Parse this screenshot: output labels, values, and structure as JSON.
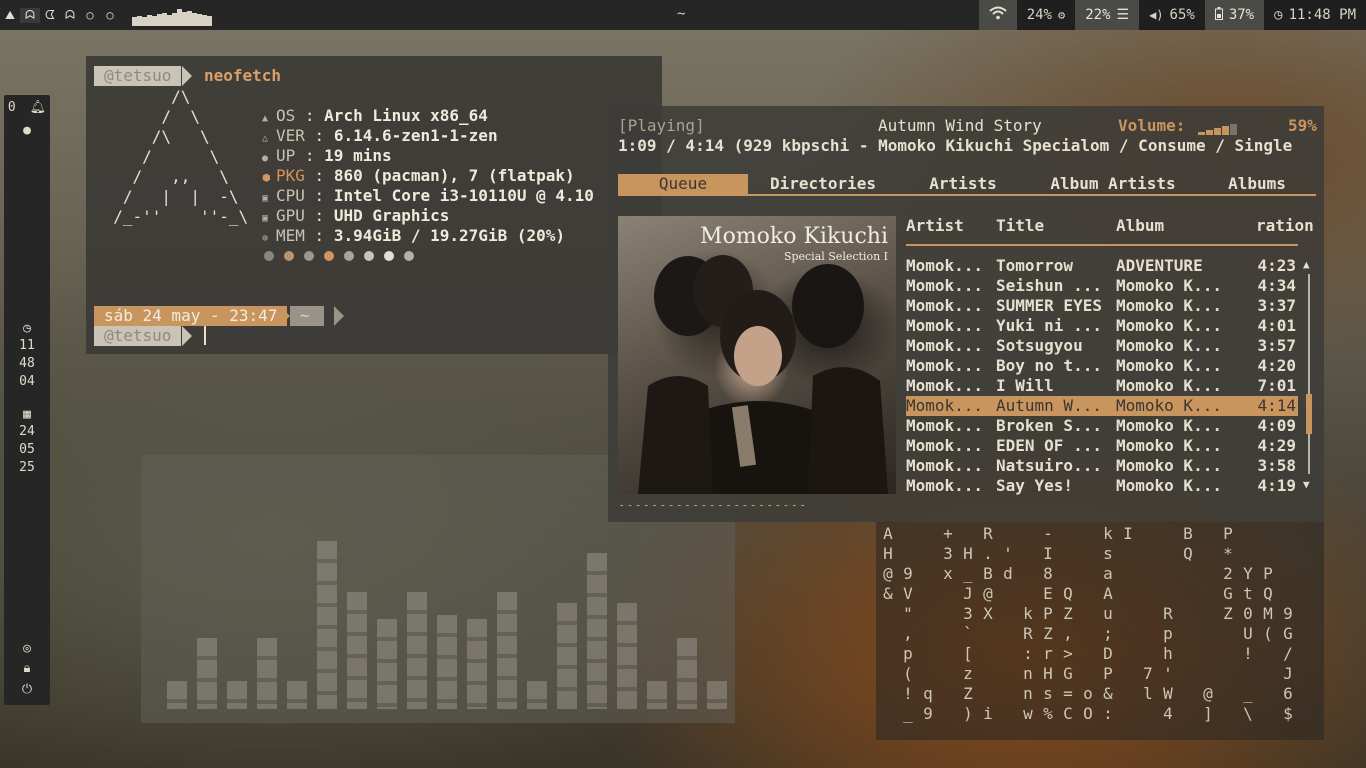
{
  "topbar": {
    "workspaces": [
      "⛰",
      "ᗣ",
      "ᗧ",
      "ᗣ",
      "○",
      "○"
    ],
    "center_title": "~",
    "wifi_icon": "wifi-icon",
    "cpu": "24%",
    "ram": "22%",
    "volume": "65%",
    "battery": "37%",
    "clock": "11:48 PM",
    "cpu_history": [
      0.25,
      0.35,
      0.3,
      0.4,
      0.35,
      0.45,
      0.5,
      0.4,
      0.5,
      0.7,
      0.55,
      0.6,
      0.5,
      0.45,
      0.4,
      0.35
    ]
  },
  "sidebar": {
    "notif_count": "0",
    "clock_h": "11",
    "clock_m": "48",
    "clock_s": "04",
    "date_d": "24",
    "date_m": "05",
    "date_y": "25"
  },
  "neofetch": {
    "user": "@tetsuo",
    "command": "neofetch",
    "logo": "        /\\\n       /  \\\n      /\\   \\\n     /      \\\n    /   ,,   \\\n   /   |  |  -\\\n  /_-''    ''-_\\",
    "rows": [
      {
        "key": "OS",
        "value": "Arch Linux x86_64",
        "icon": "arch-icon"
      },
      {
        "key": "VER",
        "value": "6.14.6-zen1-1-zen",
        "icon": "kernel-icon"
      },
      {
        "key": "UP",
        "value": "19 mins",
        "icon": "uptime-icon"
      },
      {
        "key": "PKG",
        "value": "860 (pacman), 7 (flatpak)",
        "icon": "package-icon"
      },
      {
        "key": "CPU",
        "value": "Intel Core i3-10110U @ 4.10",
        "icon": "cpu-icon"
      },
      {
        "key": "GPU",
        "value": "UHD Graphics",
        "icon": "gpu-icon"
      },
      {
        "key": "MEM",
        "value": "3.94GiB / 19.27GiB (20%)",
        "icon": "memory-icon"
      }
    ],
    "palette": [
      "#8a867c",
      "#b89470",
      "#9c988c",
      "#d4945c",
      "#a8a498",
      "#c8c4b8",
      "#e2ded4",
      "#b4b0a6"
    ],
    "date_line": "sáb 24 may - 23:47",
    "cwd": "~"
  },
  "player": {
    "state": "[Playing]",
    "track_title": "Autumn Wind Story",
    "volume_label": "Volume:",
    "volume": "59%",
    "time_info": "1:09 / 4:14 (929 kbps",
    "scroll_text": "chi - Momoko Kikuchi Specialom / Consume / Single",
    "tabs": [
      "Queue",
      "Directories",
      "Artists",
      "Album Artists",
      "Albums"
    ],
    "columns": [
      "Artist",
      "Title",
      "Album",
      "ration"
    ],
    "cover_title": "Momoko Kikuchi",
    "cover_subtitle": "Special Selection I",
    "progress": "------------------------->",
    "rows": [
      {
        "artist": "Momok...",
        "title": "Tomorrow",
        "album": "ADVENTURE",
        "duration": "4:23"
      },
      {
        "artist": "Momok...",
        "title": "Seishun ...",
        "album": "Momoko K...",
        "duration": "4:34"
      },
      {
        "artist": "Momok...",
        "title": "SUMMER EYES",
        "album": "Momoko K...",
        "duration": "3:37"
      },
      {
        "artist": "Momok...",
        "title": "Yuki ni ...",
        "album": "Momoko K...",
        "duration": "4:01"
      },
      {
        "artist": "Momok...",
        "title": "Sotsugyou",
        "album": "Momoko K...",
        "duration": "3:57"
      },
      {
        "artist": "Momok...",
        "title": "Boy no t...",
        "album": "Momoko K...",
        "duration": "4:20"
      },
      {
        "artist": "Momok...",
        "title": "I Will",
        "album": "Momoko K...",
        "duration": "7:01"
      },
      {
        "artist": "Momok...",
        "title": "Autumn W...",
        "album": "Momoko K...",
        "duration": "4:14"
      },
      {
        "artist": "Momok...",
        "title": "Broken S...",
        "album": "Momoko K...",
        "duration": "4:09"
      },
      {
        "artist": "Momok...",
        "title": "EDEN OF ...",
        "album": "Momoko K...",
        "duration": "4:29"
      },
      {
        "artist": "Momok...",
        "title": "Natsuiro...",
        "album": "Momoko K...",
        "duration": "3:58"
      },
      {
        "artist": "Momok...",
        "title": "Say Yes!",
        "album": "Momoko K...",
        "duration": "4:19"
      }
    ],
    "current_index": 7
  },
  "visualizer": {
    "levels": [
      0.12,
      0.31,
      0.12,
      0.31,
      0.12,
      0.73,
      0.51,
      0.39,
      0.51,
      0.41,
      0.39,
      0.51,
      0.12,
      0.46,
      0.68,
      0.46,
      0.12,
      0.31,
      0.12
    ]
  },
  "matrix": {
    "columns": [
      "A\nH\n@\n&",
      "\n\n9\nV\n\"\n,\np\n(\n!\n_",
      "\n\n\n\n\n\n\n\nq\n9",
      "+\n3\nx",
      "\nH\n_\nJ\n3\n`\n[\nz\nZ\n)",
      "R\n.\nB\n@\nX\n\n\n\n\ni",
      "\n'\nd",
      "\n\n\n\nk\nR\n:\nn\nn\nw",
      "-\nI\n8\nE\nP\nZ\nr\nH\ns\n%",
      "\n\n\nQ\nZ\n,\n>\nG\n=\nC",
      "\n\n\n\n\n\n\n\no\nO",
      "k\ns\na\nA\nu\n;\nD\nP\n&\n:",
      "I",
      "\n\n\n\n\n\n\n7\nl",
      "\n\n\n\nR\np\nh\n'\nW\n4",
      "B\nQ",
      "\n\n\n\n\n\n\n\n@\n]",
      "P\n*\n2\nG\nZ",
      "\n\nY\nt\n0\nU\n!\n\n_\n\\",
      "\n\nP\nQ\nM\n(",
      "\n\n\n\n9\nG\n/\nJ\n6\n$"
    ]
  }
}
